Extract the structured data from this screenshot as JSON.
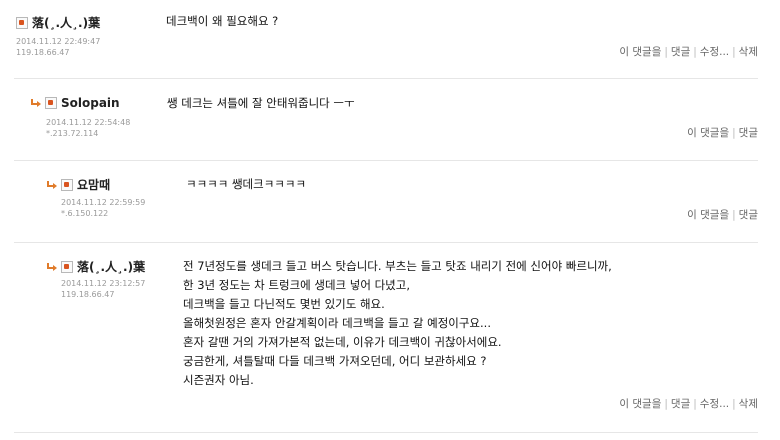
{
  "comments": [
    {
      "author": "落(¸.人¸.)葉",
      "date": "2014.11.12 22:49:47",
      "ip": "119.18.66.47",
      "lines": [
        "데크백이 왜 필요해요 ?"
      ],
      "actions": [
        "이 댓글을",
        "댓글",
        "수정...",
        "삭제"
      ]
    },
    {
      "author": "Solopain",
      "date": "2014.11.12 22:54:48",
      "ip": "*.213.72.114",
      "lines": [
        "쌩 데크는 셔틀에 잘 안태워줍니다 ㅡㅜ"
      ],
      "actions": [
        "이 댓글을",
        "댓글"
      ]
    },
    {
      "author": "요맘때",
      "date": "2014.11.12 22:59:59",
      "ip": "*.6.150.122",
      "lines": [
        "ㅋㅋㅋㅋ 쌩데크ㅋㅋㅋㅋ"
      ],
      "actions": [
        "이 댓글을",
        "댓글"
      ]
    },
    {
      "author": "落(¸.人¸.)葉",
      "date": "2014.11.12 23:12:57",
      "ip": "119.18.66.47",
      "lines": [
        "전 7년정도를 생데크 들고 버스 탓습니다. 부츠는 들고 탓죠 내리기 전에 신어야 빠르니까,",
        "한 3년 정도는 차 트렁크에 생데크 넣어 다녔고,",
        "데크백을 들고 다닌적도 몇번 있기도 해요.",
        "올해첫원정은 혼자 안갈계획이라 데크백을 들고 갈 예정이구요...",
        "혼자 갈땐 거의 가져가본적 없는데, 이유가 데크백이 귀찮아서에요.",
        "궁금한게, 셔틀탈때 다들 데크백 가져오던데, 어디 보관하세요 ?",
        "시즌권자 아님."
      ],
      "actions": [
        "이 댓글을",
        "댓글",
        "수정...",
        "삭제"
      ]
    }
  ]
}
